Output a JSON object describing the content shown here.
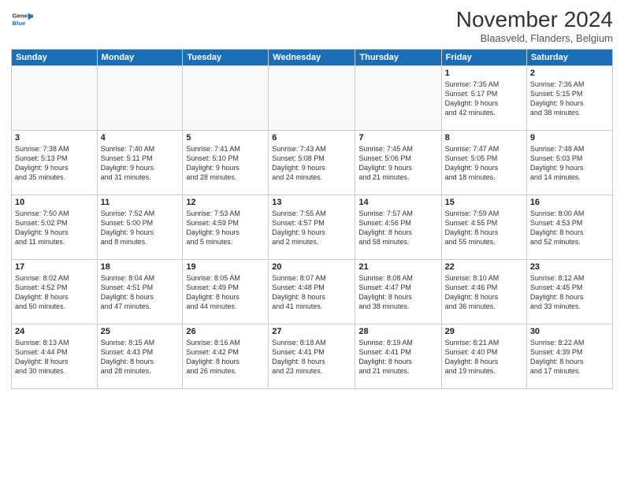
{
  "logo": {
    "line1": "General",
    "line2": "Blue"
  },
  "title": "November 2024",
  "subtitle": "Blaasveld, Flanders, Belgium",
  "weekdays": [
    "Sunday",
    "Monday",
    "Tuesday",
    "Wednesday",
    "Thursday",
    "Friday",
    "Saturday"
  ],
  "weeks": [
    [
      {
        "day": "",
        "info": ""
      },
      {
        "day": "",
        "info": ""
      },
      {
        "day": "",
        "info": ""
      },
      {
        "day": "",
        "info": ""
      },
      {
        "day": "",
        "info": ""
      },
      {
        "day": "1",
        "info": "Sunrise: 7:35 AM\nSunset: 5:17 PM\nDaylight: 9 hours\nand 42 minutes."
      },
      {
        "day": "2",
        "info": "Sunrise: 7:36 AM\nSunset: 5:15 PM\nDaylight: 9 hours\nand 38 minutes."
      }
    ],
    [
      {
        "day": "3",
        "info": "Sunrise: 7:38 AM\nSunset: 5:13 PM\nDaylight: 9 hours\nand 35 minutes."
      },
      {
        "day": "4",
        "info": "Sunrise: 7:40 AM\nSunset: 5:11 PM\nDaylight: 9 hours\nand 31 minutes."
      },
      {
        "day": "5",
        "info": "Sunrise: 7:41 AM\nSunset: 5:10 PM\nDaylight: 9 hours\nand 28 minutes."
      },
      {
        "day": "6",
        "info": "Sunrise: 7:43 AM\nSunset: 5:08 PM\nDaylight: 9 hours\nand 24 minutes."
      },
      {
        "day": "7",
        "info": "Sunrise: 7:45 AM\nSunset: 5:06 PM\nDaylight: 9 hours\nand 21 minutes."
      },
      {
        "day": "8",
        "info": "Sunrise: 7:47 AM\nSunset: 5:05 PM\nDaylight: 9 hours\nand 18 minutes."
      },
      {
        "day": "9",
        "info": "Sunrise: 7:48 AM\nSunset: 5:03 PM\nDaylight: 9 hours\nand 14 minutes."
      }
    ],
    [
      {
        "day": "10",
        "info": "Sunrise: 7:50 AM\nSunset: 5:02 PM\nDaylight: 9 hours\nand 11 minutes."
      },
      {
        "day": "11",
        "info": "Sunrise: 7:52 AM\nSunset: 5:00 PM\nDaylight: 9 hours\nand 8 minutes."
      },
      {
        "day": "12",
        "info": "Sunrise: 7:53 AM\nSunset: 4:59 PM\nDaylight: 9 hours\nand 5 minutes."
      },
      {
        "day": "13",
        "info": "Sunrise: 7:55 AM\nSunset: 4:57 PM\nDaylight: 9 hours\nand 2 minutes."
      },
      {
        "day": "14",
        "info": "Sunrise: 7:57 AM\nSunset: 4:56 PM\nDaylight: 8 hours\nand 58 minutes."
      },
      {
        "day": "15",
        "info": "Sunrise: 7:59 AM\nSunset: 4:55 PM\nDaylight: 8 hours\nand 55 minutes."
      },
      {
        "day": "16",
        "info": "Sunrise: 8:00 AM\nSunset: 4:53 PM\nDaylight: 8 hours\nand 52 minutes."
      }
    ],
    [
      {
        "day": "17",
        "info": "Sunrise: 8:02 AM\nSunset: 4:52 PM\nDaylight: 8 hours\nand 50 minutes."
      },
      {
        "day": "18",
        "info": "Sunrise: 8:04 AM\nSunset: 4:51 PM\nDaylight: 8 hours\nand 47 minutes."
      },
      {
        "day": "19",
        "info": "Sunrise: 8:05 AM\nSunset: 4:49 PM\nDaylight: 8 hours\nand 44 minutes."
      },
      {
        "day": "20",
        "info": "Sunrise: 8:07 AM\nSunset: 4:48 PM\nDaylight: 8 hours\nand 41 minutes."
      },
      {
        "day": "21",
        "info": "Sunrise: 8:08 AM\nSunset: 4:47 PM\nDaylight: 8 hours\nand 38 minutes."
      },
      {
        "day": "22",
        "info": "Sunrise: 8:10 AM\nSunset: 4:46 PM\nDaylight: 8 hours\nand 36 minutes."
      },
      {
        "day": "23",
        "info": "Sunrise: 8:12 AM\nSunset: 4:45 PM\nDaylight: 8 hours\nand 33 minutes."
      }
    ],
    [
      {
        "day": "24",
        "info": "Sunrise: 8:13 AM\nSunset: 4:44 PM\nDaylight: 8 hours\nand 30 minutes."
      },
      {
        "day": "25",
        "info": "Sunrise: 8:15 AM\nSunset: 4:43 PM\nDaylight: 8 hours\nand 28 minutes."
      },
      {
        "day": "26",
        "info": "Sunrise: 8:16 AM\nSunset: 4:42 PM\nDaylight: 8 hours\nand 26 minutes."
      },
      {
        "day": "27",
        "info": "Sunrise: 8:18 AM\nSunset: 4:41 PM\nDaylight: 8 hours\nand 23 minutes."
      },
      {
        "day": "28",
        "info": "Sunrise: 8:19 AM\nSunset: 4:41 PM\nDaylight: 8 hours\nand 21 minutes."
      },
      {
        "day": "29",
        "info": "Sunrise: 8:21 AM\nSunset: 4:40 PM\nDaylight: 8 hours\nand 19 minutes."
      },
      {
        "day": "30",
        "info": "Sunrise: 8:22 AM\nSunset: 4:39 PM\nDaylight: 8 hours\nand 17 minutes."
      }
    ]
  ]
}
